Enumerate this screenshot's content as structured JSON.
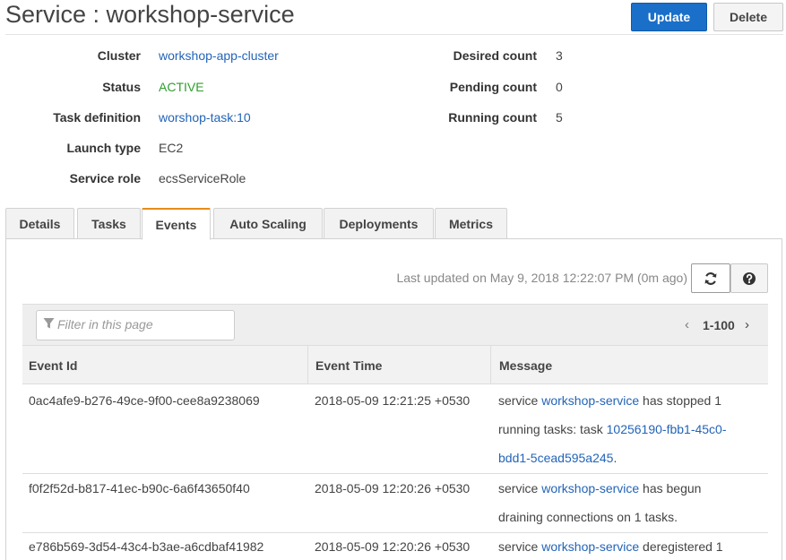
{
  "page": {
    "title": "Service : workshop-service"
  },
  "actions": {
    "update_label": "Update",
    "delete_label": "Delete"
  },
  "details_left": [
    {
      "label": "Cluster",
      "value": "workshop-app-cluster"
    },
    {
      "label": "Status",
      "value": "ACTIVE"
    },
    {
      "label": "Task definition",
      "value": "worshop-task:10"
    },
    {
      "label": "Launch type",
      "value": "EC2"
    },
    {
      "label": "Service role",
      "value": "ecsServiceRole"
    }
  ],
  "details_right": [
    {
      "label": "Desired count",
      "value": "3"
    },
    {
      "label": "Pending count",
      "value": "0"
    },
    {
      "label": "Running count",
      "value": "5"
    }
  ],
  "tabs": [
    {
      "label": "Details"
    },
    {
      "label": "Tasks"
    },
    {
      "label": "Events"
    },
    {
      "label": "Auto Scaling"
    },
    {
      "label": "Deployments"
    },
    {
      "label": "Metrics"
    }
  ],
  "active_tab": "Events",
  "events": {
    "last_updated": "Last updated on May 9, 2018 12:22:07 PM (0m ago)",
    "refresh_icon": "refresh-icon",
    "help_icon": "help-icon",
    "filter_placeholder": "Filter in this page",
    "filter_icon": "funnel-icon",
    "pager": {
      "prev": "‹",
      "range": "1-100",
      "next": "›"
    },
    "columns": [
      "Event Id",
      "Event Time",
      "Message"
    ],
    "rows": [
      {
        "id": "0ac4afe9-b276-49ce-9f00-cee8a9238069",
        "time": "2018-05-09 12:21:25 +0530",
        "msg_prefix": "service ",
        "msg_link": "workshop-service",
        "msg_mid": " has stopped 1",
        "msg_line2": "running tasks: task ",
        "msg_link2": "10256190-fbb1-45c0-",
        "msg_link2_line2": "bdd1-5cead595a245",
        "msg_suffix": "."
      },
      {
        "id": "f0f2f52d-b817-41ec-b90c-6a6f43650f40",
        "time": "2018-05-09 12:20:26 +0530",
        "msg_prefix": "service ",
        "msg_link": "workshop-service",
        "msg_mid": " has begun",
        "msg_line2": "draining connections on 1 tasks."
      },
      {
        "id": "e786b569-3d54-43c4-b3ae-a6cdbaf41982",
        "time": "2018-05-09 12:20:26 +0530",
        "msg_prefix": "service ",
        "msg_link": "workshop-service",
        "msg_mid": " deregistered 1"
      }
    ]
  },
  "colors": {
    "primary_button": "#1a6fc9",
    "link": "#2364b8",
    "status_active": "#2e9e2e",
    "active_tab_accent": "#e88b1a"
  }
}
